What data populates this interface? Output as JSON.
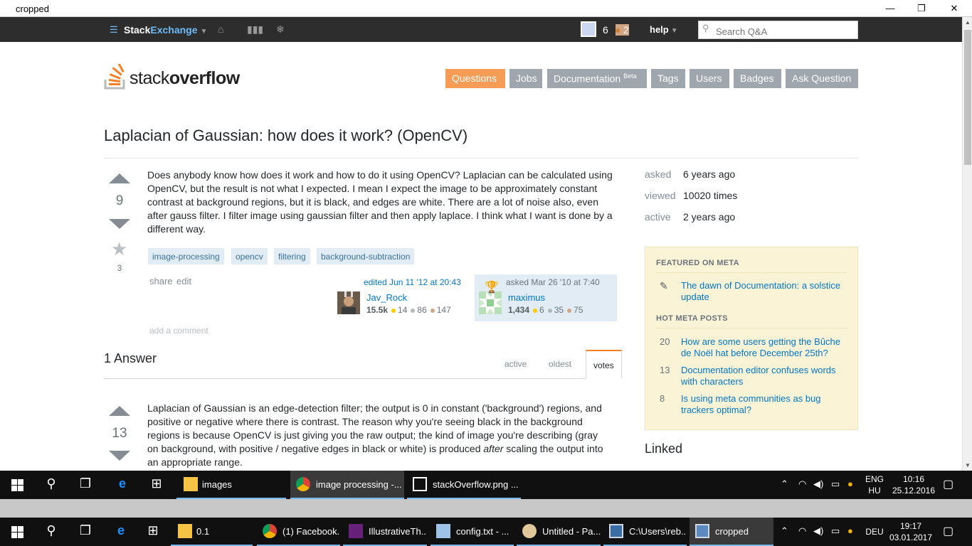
{
  "window": {
    "title": "cropped",
    "minimize": "—",
    "restore": "❐",
    "close": "✕"
  },
  "topbar": {
    "brand_stack": "Stack",
    "brand_exchange": "Exchange",
    "brand_caret": "▼",
    "reputation": "6",
    "bronze_badges": "2",
    "help_label": "help",
    "help_caret": "▼",
    "search_placeholder": "Search Q&A"
  },
  "header": {
    "logo_stack": "stack",
    "logo_overflow": "overflow",
    "nav": [
      {
        "label": "Questions",
        "active": true
      },
      {
        "label": "Jobs"
      },
      {
        "label": "Documentation",
        "sup": "Beta"
      },
      {
        "label": "Tags"
      },
      {
        "label": "Users"
      },
      {
        "label": "Badges"
      },
      {
        "label": "Ask Question"
      }
    ]
  },
  "question": {
    "title": "Laplacian of Gaussian: how does it work? (OpenCV)",
    "votes": "9",
    "favorites": "3",
    "body": "Does anybody know how does it work and how to do it using OpenCV? Laplacian can be calculated using OpenCV, but the result is not what I expected. I mean I expect the image to be approximately constant contrast at background regions, but it is black, and edges are white. There are a lot of noise also, even after gauss filter. I filter image using gaussian filter and then apply laplace. I think what I want is done by a different way.",
    "tags": [
      "image-processing",
      "opencv",
      "filtering",
      "background-subtraction"
    ],
    "share_label": "share",
    "edit_label": "edit",
    "editor": {
      "action": "edited Jun 11 '12 at 20:43",
      "name": "Jav_Rock",
      "rep": "15.5k",
      "gold": "14",
      "silver": "86",
      "bronze": "147"
    },
    "owner": {
      "action": "asked Mar 26 '10 at 7:40",
      "name": "maximus",
      "rep": "1,434",
      "gold": "6",
      "silver": "35",
      "bronze": "75"
    },
    "add_comment": "add a comment"
  },
  "answers": {
    "heading": "1 Answer",
    "sort_tabs": [
      "active",
      "oldest",
      "votes"
    ],
    "selected_tab": "votes",
    "first": {
      "votes": "13",
      "body_1": "Laplacian of Gaussian is an edge-detection filter; the output is 0 in constant ('background') regions, and positive or negative where there is contrast. The reason why you're seeing black in the background regions is because OpenCV is just giving you the raw output; the kind of image you're describing (gray on background, with positive / negative edges in black or white) is produced ",
      "body_em": "after",
      "body_2": " scaling the output into an appropriate range."
    }
  },
  "sidebar": {
    "asked_label": "asked",
    "asked_value": "6 years ago",
    "viewed_label": "viewed",
    "viewed_value": "10020 times",
    "active_label": "active",
    "active_value": "2 years ago",
    "featured_heading": "FEATURED ON META",
    "featured": [
      {
        "text": "The dawn of Documentation: a solstice update"
      }
    ],
    "hot_heading": "HOT META POSTS",
    "hot": [
      {
        "score": "20",
        "text": "How are some users getting the Bûche de Noël hat before December 25th?"
      },
      {
        "score": "13",
        "text": "Documentation editor confuses words with characters"
      },
      {
        "score": "8",
        "text": "Is using meta communities as bug trackers optimal?"
      }
    ],
    "linked_heading": "Linked"
  },
  "taskbar_inner": {
    "apps": [
      {
        "label": "images"
      },
      {
        "label": "image processing -..."
      },
      {
        "label": "stackOverflow.png ..."
      }
    ],
    "lang_top": "ENG",
    "lang_bottom": "HU",
    "time": "10:16",
    "date": "25.12.2016"
  },
  "taskbar_outer": {
    "apps": [
      {
        "label": "0.1"
      },
      {
        "label": "(1) Facebook..."
      },
      {
        "label": "IllustrativeTh..."
      },
      {
        "label": "config.txt - ..."
      },
      {
        "label": "Untitled - Pa..."
      },
      {
        "label": "C:\\Users\\reb..."
      },
      {
        "label": "cropped"
      }
    ],
    "lang": "DEU",
    "time": "19:17",
    "date": "03.01.2017"
  },
  "colors": {
    "accent_orange": "#f48024",
    "link_blue": "#0077cc",
    "tag_bg": "#e1ecf4",
    "meta_box": "#fbf3d5"
  }
}
